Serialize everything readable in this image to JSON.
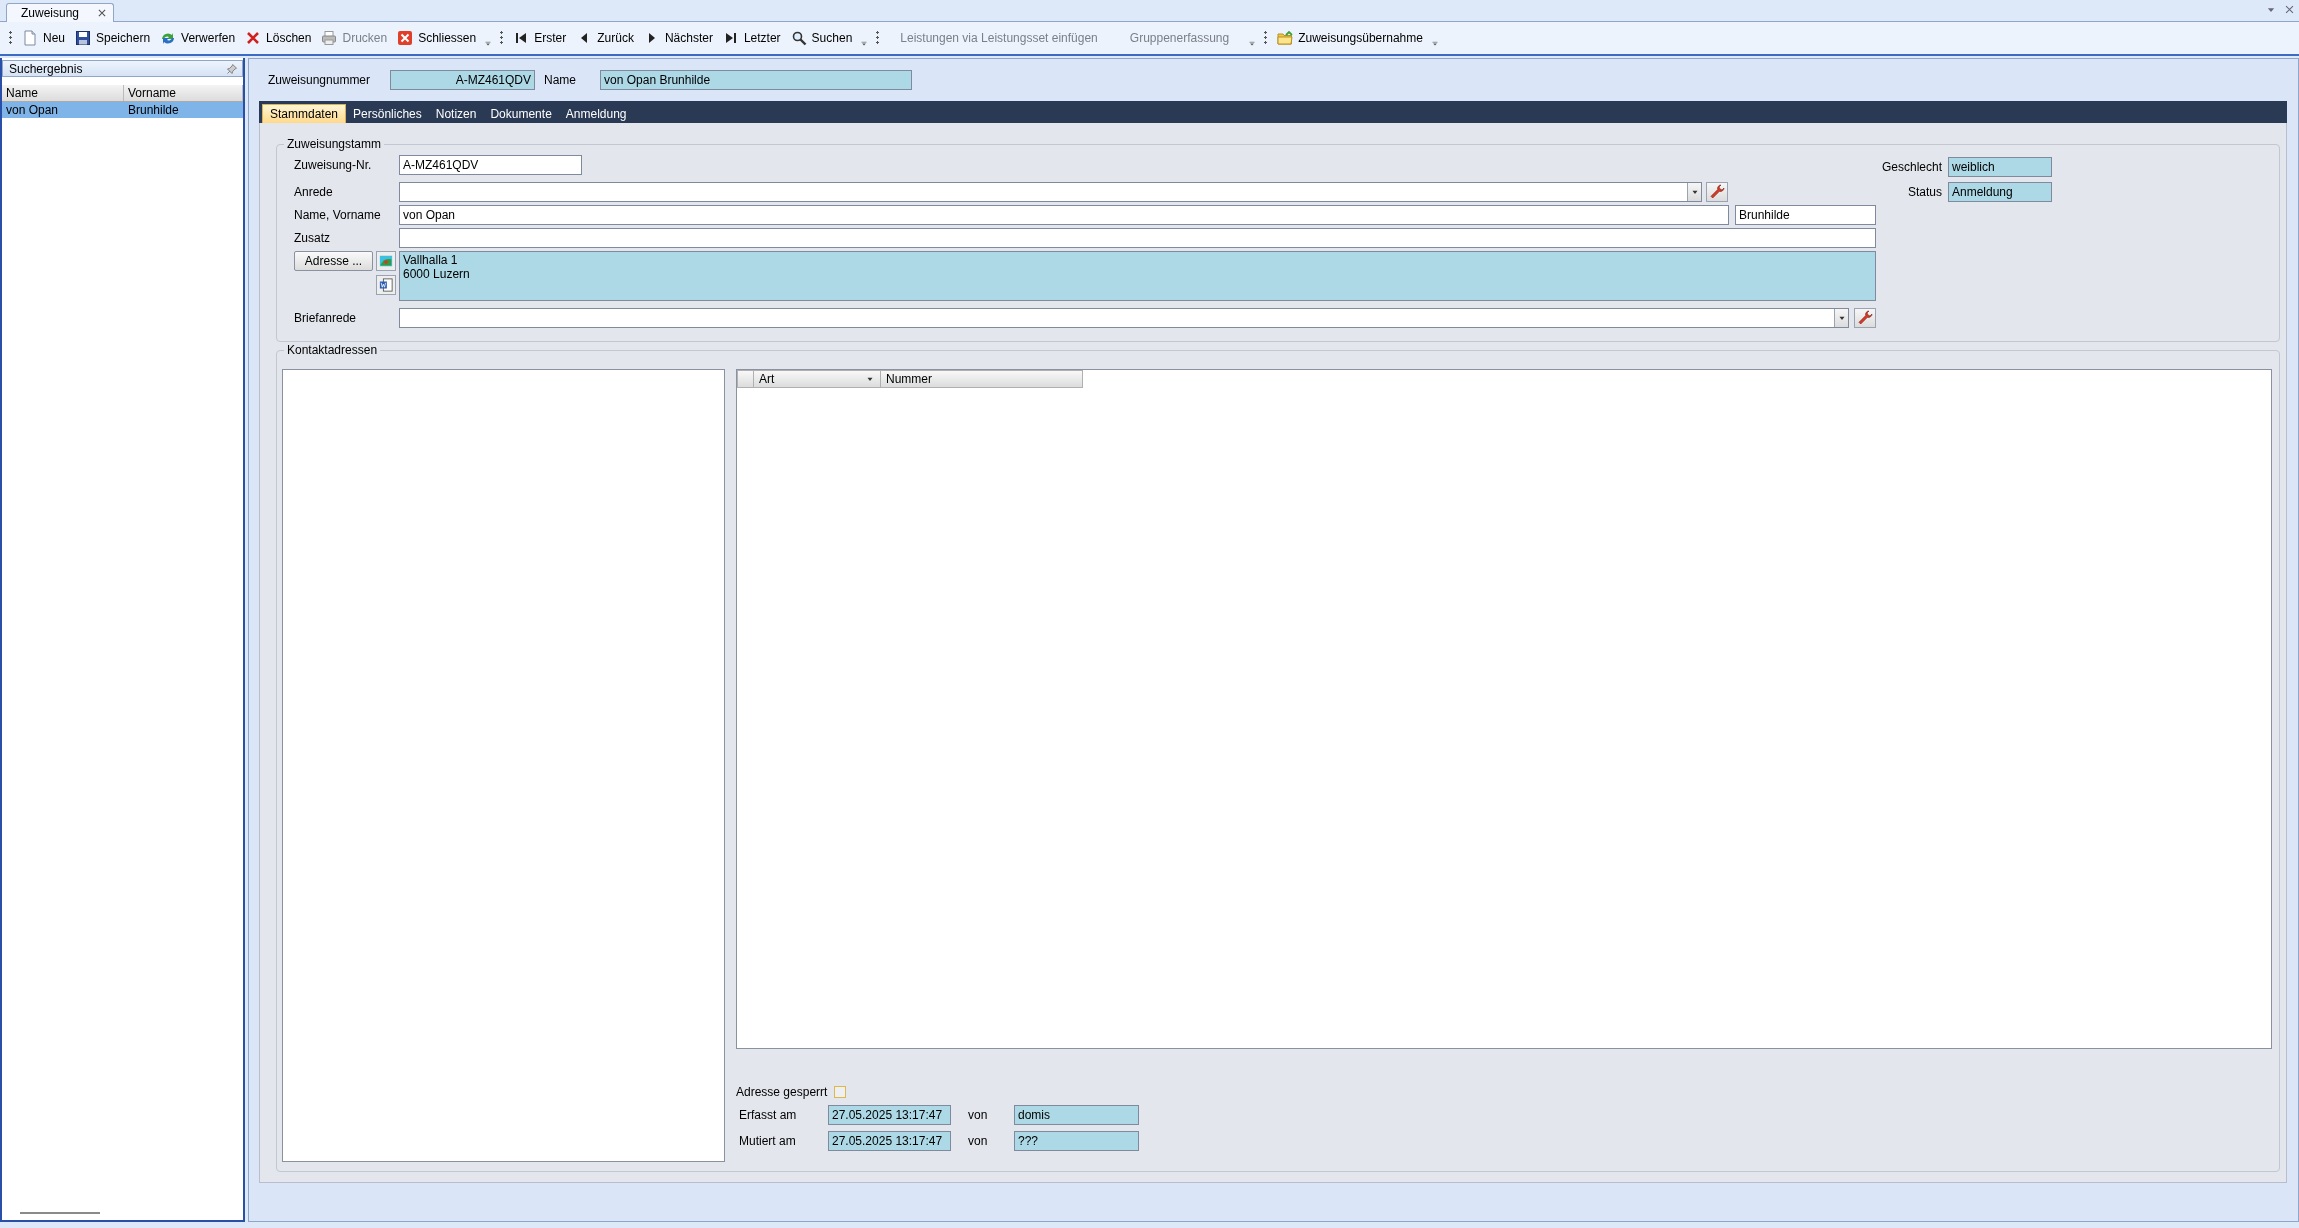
{
  "document_tabs": [
    {
      "label": "Zuweisung",
      "selected": true
    }
  ],
  "toolbar": {
    "groups": [
      {
        "items": [
          {
            "label": "Neu",
            "disabled": false
          },
          {
            "label": "Speichern",
            "disabled": false
          },
          {
            "label": "Verwerfen",
            "disabled": false
          },
          {
            "label": "Löschen",
            "disabled": false
          },
          {
            "label": "Drucken",
            "disabled": true
          },
          {
            "label": "Schliessen",
            "disabled": false
          }
        ]
      },
      {
        "items": [
          {
            "label": "Erster",
            "disabled": false
          },
          {
            "label": "Zurück",
            "disabled": false
          },
          {
            "label": "Nächster",
            "disabled": false
          },
          {
            "label": "Letzter",
            "disabled": false
          },
          {
            "label": "Suchen",
            "disabled": false
          }
        ]
      },
      {
        "items": [
          {
            "label": "Leistungen via Leistungsset einfügen",
            "disabled": true
          },
          {
            "label": "Gruppenerfassung",
            "disabled": true
          }
        ]
      },
      {
        "items": [
          {
            "label": "Zuweisungsübernahme",
            "disabled": false
          }
        ]
      }
    ]
  },
  "search_panel": {
    "title": "Suchergebnis",
    "columns": [
      "Name",
      "Vorname"
    ],
    "rows": [
      {
        "cells": [
          "von Opan",
          "Brunhilde"
        ],
        "selected": true
      }
    ]
  },
  "header": {
    "number_label": "Zuweisungnummer",
    "number": "A-MZ461QDV",
    "name_label": "Name",
    "name": "von Opan Brunhilde"
  },
  "tabs": [
    {
      "label": "Stammdaten",
      "selected": true
    },
    {
      "label": "Persönliches",
      "selected": false
    },
    {
      "label": "Notizen",
      "selected": false
    },
    {
      "label": "Dokumente",
      "selected": false
    },
    {
      "label": "Anmeldung",
      "selected": false
    }
  ],
  "stamm": {
    "title": "Zuweisungstamm",
    "nr": {
      "label": "Zuweisung-Nr.",
      "value": "A-MZ461QDV"
    },
    "anrede": {
      "label": "Anrede"
    },
    "name": {
      "label": "Name, Vorname",
      "value": "von Opan",
      "vorname": "Brunhilde"
    },
    "zusatz": {
      "label": "Zusatz"
    },
    "adresse": {
      "button": "Adresse ...",
      "lines": [
        "Vallhalla 1",
        "6000 Luzern"
      ]
    },
    "briefanrede": {
      "label": "Briefanrede"
    },
    "geschlecht": {
      "label": "Geschlecht",
      "value": "weiblich"
    },
    "status": {
      "label": "Status",
      "value": "Anmeldung"
    }
  },
  "kontakt": {
    "title": "Kontaktadressen",
    "columns": [
      {
        "label": "Art",
        "kind": "filter"
      },
      {
        "label": "Nummer",
        "kind": "plain"
      }
    ],
    "gesperrt": {
      "label": "Adresse gesperrt",
      "checked": false
    },
    "erfasst": {
      "label": "Erfasst am",
      "value": "27.05.2025 13:17:47",
      "by_label": "von",
      "by": "domis"
    },
    "mutiert": {
      "label": "Mutiert am",
      "value": "27.05.2025 13:17:47",
      "by_label": "von",
      "by": "???"
    }
  }
}
